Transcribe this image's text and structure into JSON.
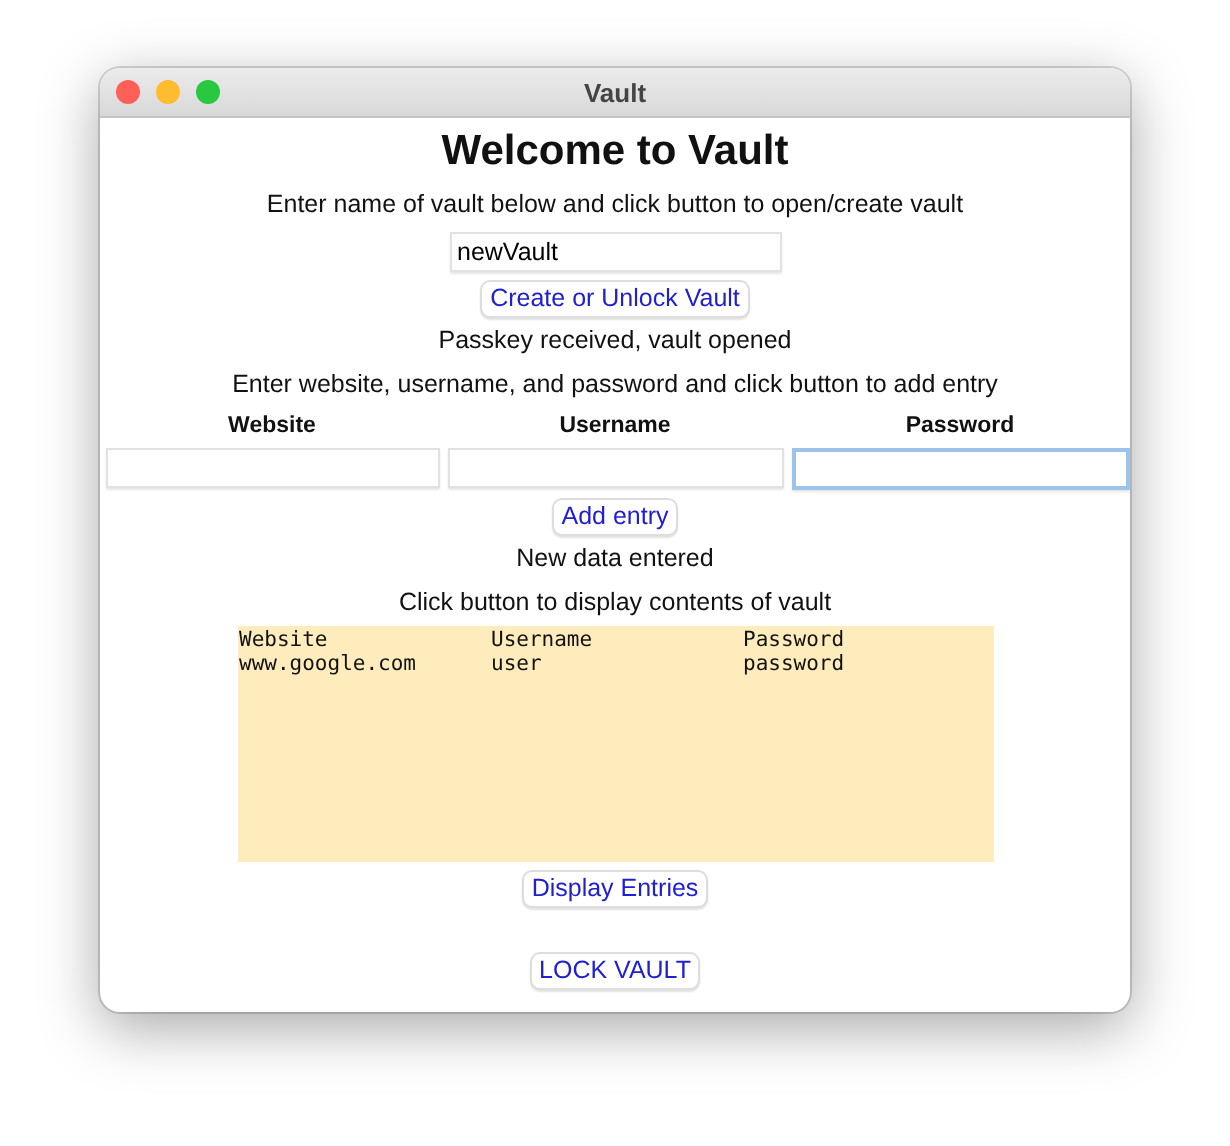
{
  "window": {
    "title": "Vault"
  },
  "heading": "Welcome to Vault",
  "vault_prompt": "Enter name of vault below and click button to open/create vault",
  "vault_name_field": {
    "value": "newVault"
  },
  "unlock_button": "Create or Unlock Vault",
  "vault_status": "Passkey received, vault opened",
  "entry_prompt": "Enter website, username, and password and click button to add entry",
  "entry_fields": [
    {
      "label": "Website",
      "focused": false
    },
    {
      "label": "Username",
      "focused": false
    },
    {
      "label": "Password",
      "focused": true
    }
  ],
  "add_button": "Add entry",
  "entry_status": "New data entered",
  "display_prompt": "Click button to display contents of vault",
  "output": {
    "rows": [
      [
        "Website",
        "Username",
        "Password"
      ],
      [
        "www.google.com",
        "user",
        "password"
      ]
    ]
  },
  "display_button": "Display Entries",
  "lock_button": "LOCK VAULT"
}
